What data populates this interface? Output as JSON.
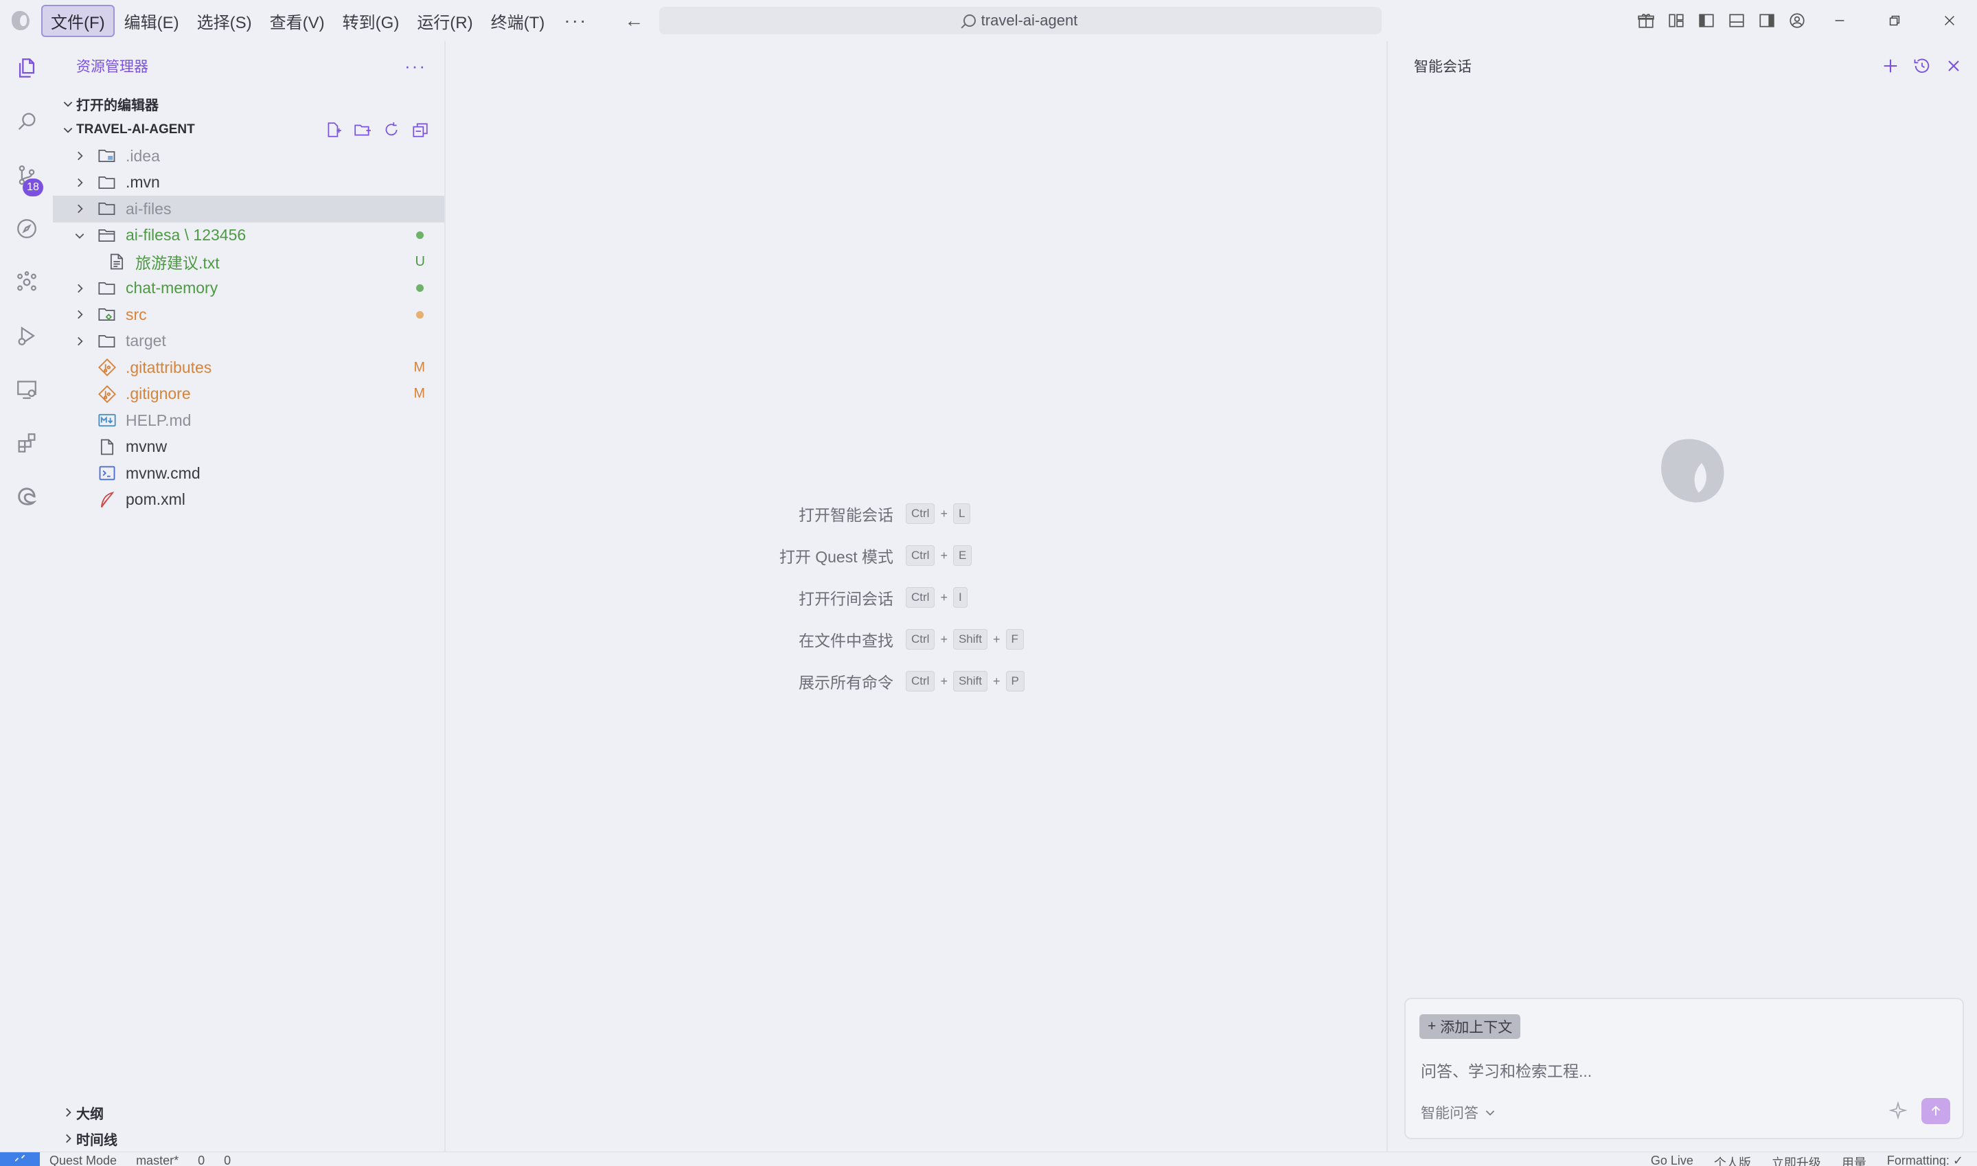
{
  "titlebar": {
    "menu": [
      "文件(F)",
      "编辑(E)",
      "选择(S)",
      "查看(V)",
      "转到(G)",
      "运行(R)",
      "终端(T)"
    ],
    "more": "···",
    "search_text": "travel-ai-agent"
  },
  "activity": {
    "scm_badge": "18"
  },
  "sidebar": {
    "title": "资源管理器",
    "more": "···",
    "open_editors": "打开的编辑器",
    "project": "TRAVEL-AI-AGENT",
    "tree": [
      {
        "name": ".idea",
        "status": "",
        "kind": "folder-special"
      },
      {
        "name": ".mvn",
        "status": "",
        "kind": "folder"
      },
      {
        "name": "ai-files",
        "status": "",
        "kind": "folder"
      },
      {
        "name": "ai-filesa \\ 123456",
        "status": "",
        "kind": "folder-open"
      },
      {
        "name": "旅游建议.txt",
        "status": "U",
        "kind": "file"
      },
      {
        "name": "chat-memory",
        "status": "",
        "kind": "folder"
      },
      {
        "name": "src",
        "status": "",
        "kind": "folder-src"
      },
      {
        "name": "target",
        "status": "",
        "kind": "folder"
      },
      {
        "name": ".gitattributes",
        "status": "M",
        "kind": "git"
      },
      {
        "name": ".gitignore",
        "status": "M",
        "kind": "git"
      },
      {
        "name": "HELP.md",
        "status": "",
        "kind": "md"
      },
      {
        "name": "mvnw",
        "status": "",
        "kind": "file"
      },
      {
        "name": "mvnw.cmd",
        "status": "",
        "kind": "cmd"
      },
      {
        "name": "pom.xml",
        "status": "",
        "kind": "xml"
      }
    ],
    "outline": "大纲",
    "timeline": "时间线"
  },
  "editor": {
    "hints": [
      {
        "label": "打开智能会话",
        "keys": [
          "Ctrl",
          "L"
        ]
      },
      {
        "label": "打开 Quest 模式",
        "keys": [
          "Ctrl",
          "E"
        ]
      },
      {
        "label": "打开行间会话",
        "keys": [
          "Ctrl",
          "I"
        ]
      },
      {
        "label": "在文件中查找",
        "keys": [
          "Ctrl",
          "Shift",
          "F"
        ]
      },
      {
        "label": "展示所有命令",
        "keys": [
          "Ctrl",
          "Shift",
          "P"
        ]
      }
    ]
  },
  "chat": {
    "title": "智能会话",
    "add_context": "添加上下文",
    "placeholder": "问答、学习和检索工程...",
    "mode": "智能问答"
  },
  "statusbar": {
    "left": [
      "Quest Mode",
      "master*",
      "0",
      "0"
    ],
    "right": [
      "Go Live",
      "个人版",
      "立即升级",
      "用量",
      "Formatting: ✓"
    ]
  },
  "colors": {
    "accent": "#7b52e0",
    "git_untracked": "#4d9a42",
    "git_modified": "#d7833a",
    "remote": "#3f7fe8"
  }
}
